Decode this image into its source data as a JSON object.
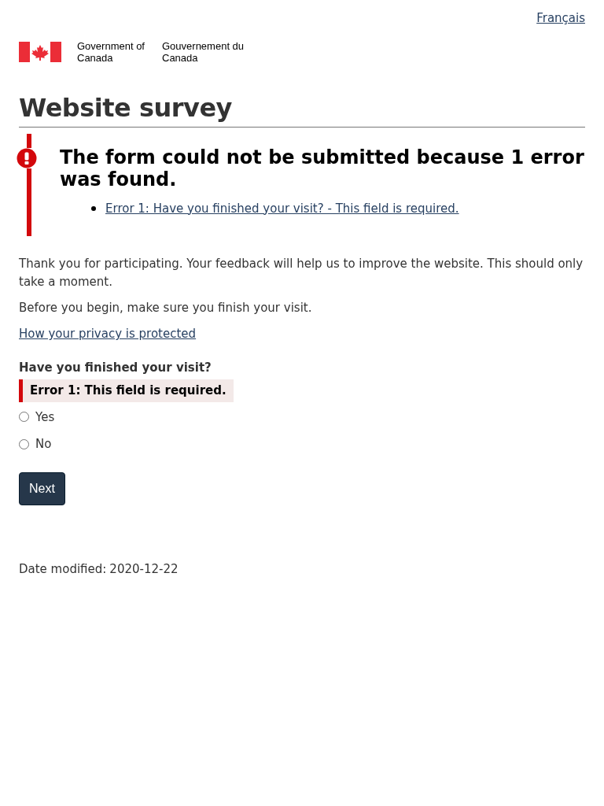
{
  "language_link": "Français",
  "wordmark": {
    "english": "Government of Canada",
    "french": "Gouvernement du Canada"
  },
  "title": "Website survey",
  "error_summary": {
    "heading": "The form could not be submitted because 1 error was found.",
    "errors": [
      "Error 1: Have you finished your visit? - This field is required."
    ]
  },
  "intro": [
    "Thank you for participating. Your feedback will help us to improve the website. This should only take a moment.",
    "Before you begin, make sure you finish your visit."
  ],
  "privacy_link": "How your privacy is protected",
  "question": {
    "label": "Have you finished your visit?",
    "error": "Error 1: This field is required.",
    "options": [
      {
        "label": "Yes",
        "selected": false
      },
      {
        "label": "No",
        "selected": false
      }
    ]
  },
  "next_button": "Next",
  "date_modified": {
    "label": "Date modified:",
    "value": "2020-12-22"
  }
}
